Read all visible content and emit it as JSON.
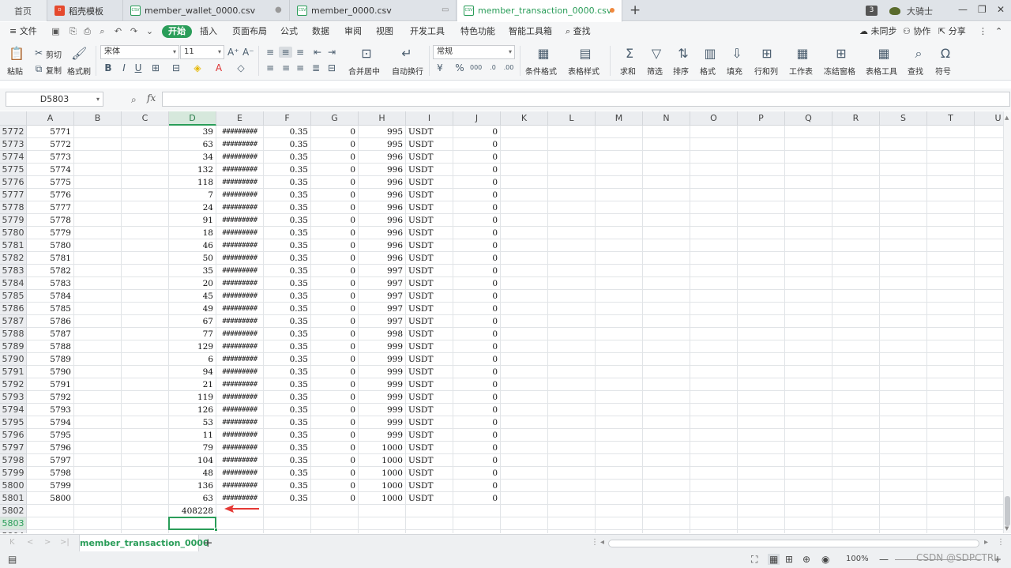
{
  "tabs": [
    {
      "label": "首页",
      "icon": "none"
    },
    {
      "label": "稻壳模板",
      "icon": "daoke-icon"
    },
    {
      "label": "member_wallet_0000.csv",
      "icon": "csv-icon"
    },
    {
      "label": "member_0000.csv",
      "icon": "csv-icon"
    },
    {
      "label": "member_transaction_0000.csv",
      "icon": "csv-icon"
    }
  ],
  "topbar": {
    "badge": "3",
    "user": "大骑士"
  },
  "menu": {
    "file": "文件",
    "items": [
      "开始",
      "插入",
      "页面布局",
      "公式",
      "数据",
      "审阅",
      "视图",
      "开发工具",
      "特色功能",
      "智能工具箱"
    ],
    "search": "查找",
    "sync": "未同步",
    "collab": "协作",
    "share": "分享"
  },
  "ribbon": {
    "paste": "粘贴",
    "cut": "剪切",
    "copy": "复制",
    "format_painter": "格式刷",
    "font_name": "宋体",
    "font_size": "11",
    "merge_center": "合并居中",
    "wrap": "自动换行",
    "number_format": "常规",
    "cond_format": "条件格式",
    "table_style": "表格样式",
    "sum": "求和",
    "filter": "筛选",
    "sort": "排序",
    "format": "格式",
    "fill": "填充",
    "row_col": "行和列",
    "worksheet": "工作表",
    "freeze": "冻结窗格",
    "table_tools": "表格工具",
    "find": "查找",
    "symbol": "符号"
  },
  "formula": {
    "name_box": "D5803",
    "fx": "fx",
    "value": ""
  },
  "columns": [
    "A",
    "B",
    "C",
    "D",
    "E",
    "F",
    "G",
    "H",
    "I",
    "J",
    "K",
    "L",
    "M",
    "N",
    "O",
    "P",
    "Q",
    "R",
    "S",
    "T",
    "U"
  ],
  "selected_column": "D",
  "rows": [
    {
      "n": "5772",
      "a": "5771",
      "d": "39",
      "e": "#########",
      "f": "0.35",
      "g": "0",
      "h": "995",
      "i": "USDT",
      "j": "0"
    },
    {
      "n": "5773",
      "a": "5772",
      "d": "63",
      "e": "#########",
      "f": "0.35",
      "g": "0",
      "h": "995",
      "i": "USDT",
      "j": "0"
    },
    {
      "n": "5774",
      "a": "5773",
      "d": "34",
      "e": "#########",
      "f": "0.35",
      "g": "0",
      "h": "996",
      "i": "USDT",
      "j": "0"
    },
    {
      "n": "5775",
      "a": "5774",
      "d": "132",
      "e": "#########",
      "f": "0.35",
      "g": "0",
      "h": "996",
      "i": "USDT",
      "j": "0"
    },
    {
      "n": "5776",
      "a": "5775",
      "d": "118",
      "e": "#########",
      "f": "0.35",
      "g": "0",
      "h": "996",
      "i": "USDT",
      "j": "0"
    },
    {
      "n": "5777",
      "a": "5776",
      "d": "7",
      "e": "#########",
      "f": "0.35",
      "g": "0",
      "h": "996",
      "i": "USDT",
      "j": "0"
    },
    {
      "n": "5778",
      "a": "5777",
      "d": "24",
      "e": "#########",
      "f": "0.35",
      "g": "0",
      "h": "996",
      "i": "USDT",
      "j": "0"
    },
    {
      "n": "5779",
      "a": "5778",
      "d": "91",
      "e": "#########",
      "f": "0.35",
      "g": "0",
      "h": "996",
      "i": "USDT",
      "j": "0"
    },
    {
      "n": "5780",
      "a": "5779",
      "d": "18",
      "e": "#########",
      "f": "0.35",
      "g": "0",
      "h": "996",
      "i": "USDT",
      "j": "0"
    },
    {
      "n": "5781",
      "a": "5780",
      "d": "46",
      "e": "#########",
      "f": "0.35",
      "g": "0",
      "h": "996",
      "i": "USDT",
      "j": "0"
    },
    {
      "n": "5782",
      "a": "5781",
      "d": "50",
      "e": "#########",
      "f": "0.35",
      "g": "0",
      "h": "996",
      "i": "USDT",
      "j": "0"
    },
    {
      "n": "5783",
      "a": "5782",
      "d": "35",
      "e": "#########",
      "f": "0.35",
      "g": "0",
      "h": "997",
      "i": "USDT",
      "j": "0"
    },
    {
      "n": "5784",
      "a": "5783",
      "d": "20",
      "e": "#########",
      "f": "0.35",
      "g": "0",
      "h": "997",
      "i": "USDT",
      "j": "0"
    },
    {
      "n": "5785",
      "a": "5784",
      "d": "45",
      "e": "#########",
      "f": "0.35",
      "g": "0",
      "h": "997",
      "i": "USDT",
      "j": "0"
    },
    {
      "n": "5786",
      "a": "5785",
      "d": "49",
      "e": "#########",
      "f": "0.35",
      "g": "0",
      "h": "997",
      "i": "USDT",
      "j": "0"
    },
    {
      "n": "5787",
      "a": "5786",
      "d": "67",
      "e": "#########",
      "f": "0.35",
      "g": "0",
      "h": "997",
      "i": "USDT",
      "j": "0"
    },
    {
      "n": "5788",
      "a": "5787",
      "d": "77",
      "e": "#########",
      "f": "0.35",
      "g": "0",
      "h": "998",
      "i": "USDT",
      "j": "0"
    },
    {
      "n": "5789",
      "a": "5788",
      "d": "129",
      "e": "#########",
      "f": "0.35",
      "g": "0",
      "h": "999",
      "i": "USDT",
      "j": "0"
    },
    {
      "n": "5790",
      "a": "5789",
      "d": "6",
      "e": "#########",
      "f": "0.35",
      "g": "0",
      "h": "999",
      "i": "USDT",
      "j": "0"
    },
    {
      "n": "5791",
      "a": "5790",
      "d": "94",
      "e": "#########",
      "f": "0.35",
      "g": "0",
      "h": "999",
      "i": "USDT",
      "j": "0"
    },
    {
      "n": "5792",
      "a": "5791",
      "d": "21",
      "e": "#########",
      "f": "0.35",
      "g": "0",
      "h": "999",
      "i": "USDT",
      "j": "0"
    },
    {
      "n": "5793",
      "a": "5792",
      "d": "119",
      "e": "#########",
      "f": "0.35",
      "g": "0",
      "h": "999",
      "i": "USDT",
      "j": "0"
    },
    {
      "n": "5794",
      "a": "5793",
      "d": "126",
      "e": "#########",
      "f": "0.35",
      "g": "0",
      "h": "999",
      "i": "USDT",
      "j": "0"
    },
    {
      "n": "5795",
      "a": "5794",
      "d": "53",
      "e": "#########",
      "f": "0.35",
      "g": "0",
      "h": "999",
      "i": "USDT",
      "j": "0"
    },
    {
      "n": "5796",
      "a": "5795",
      "d": "11",
      "e": "#########",
      "f": "0.35",
      "g": "0",
      "h": "999",
      "i": "USDT",
      "j": "0"
    },
    {
      "n": "5797",
      "a": "5796",
      "d": "79",
      "e": "#########",
      "f": "0.35",
      "g": "0",
      "h": "1000",
      "i": "USDT",
      "j": "0"
    },
    {
      "n": "5798",
      "a": "5797",
      "d": "104",
      "e": "#########",
      "f": "0.35",
      "g": "0",
      "h": "1000",
      "i": "USDT",
      "j": "0"
    },
    {
      "n": "5799",
      "a": "5798",
      "d": "48",
      "e": "#########",
      "f": "0.35",
      "g": "0",
      "h": "1000",
      "i": "USDT",
      "j": "0"
    },
    {
      "n": "5800",
      "a": "5799",
      "d": "136",
      "e": "#########",
      "f": "0.35",
      "g": "0",
      "h": "1000",
      "i": "USDT",
      "j": "0"
    },
    {
      "n": "5801",
      "a": "5800",
      "d": "63",
      "e": "#########",
      "f": "0.35",
      "g": "0",
      "h": "1000",
      "i": "USDT",
      "j": "0"
    },
    {
      "n": "5802",
      "a": "",
      "d": "408228",
      "e": "",
      "f": "",
      "g": "",
      "h": "",
      "i": "",
      "j": ""
    },
    {
      "n": "5803",
      "a": "",
      "d": "",
      "e": "",
      "f": "",
      "g": "",
      "h": "",
      "i": "",
      "j": ""
    },
    {
      "n": "5804",
      "a": "",
      "d": "",
      "e": "",
      "f": "",
      "g": "",
      "h": "",
      "i": "",
      "j": ""
    }
  ],
  "selected_row": "5803",
  "sheet": {
    "name": "member_transaction_0000"
  },
  "status": {
    "zoom": "100%"
  },
  "watermark": "CSDN @SDPCTRL",
  "colors": {
    "accent": "#2a9d59",
    "arrow": "#e53935",
    "orange_dot": "#f0883e"
  }
}
